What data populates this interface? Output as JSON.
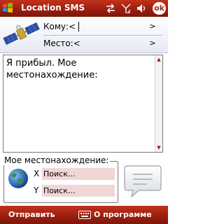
{
  "title_bar": {
    "app_title": "Location SMS",
    "ok_label": "ok",
    "icons": [
      "windows-logo-icon",
      "sync-icon",
      "signal-icon",
      "speaker-icon"
    ]
  },
  "recipient": {
    "to_label": "Кому:<",
    "place_label": "Место:<",
    "chevron": ">"
  },
  "message": {
    "body": "Я прибыл. Мое местонахождение:"
  },
  "location": {
    "group_label": "Мое местонахождение:",
    "x_label": "X",
    "y_label": "Y",
    "x_value": "Поиск...",
    "y_value": "Поиск..."
  },
  "softkeys": {
    "left": "Отправить",
    "right": "О программе"
  },
  "colors": {
    "bar_red": "#9b1f0f",
    "field_pink": "#f1d6d6"
  }
}
